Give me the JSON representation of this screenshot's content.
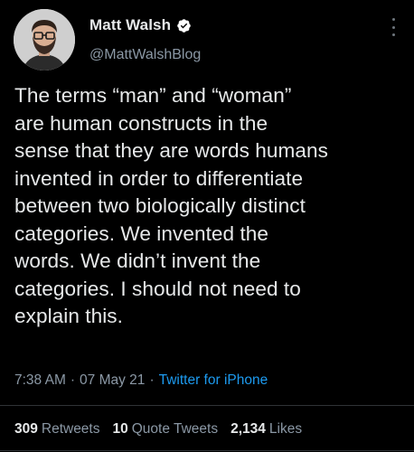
{
  "author": {
    "name": "Matt Walsh",
    "handle": "@MattWalshBlog",
    "verified_icon": "verified-badge-icon"
  },
  "tweet": {
    "text": "The terms “man” and “woman”\nare human constructs in the\nsense that they are words humans\ninvented in order to differentiate\nbetween two biologically distinct\ncategories. We invented the\nwords. We didn’t invent the\ncategories. I should not need to\nexplain this."
  },
  "meta": {
    "time": "7:38 AM",
    "separator1": "·",
    "date": "07 May 21",
    "separator2": "·",
    "source": "Twitter for iPhone"
  },
  "stats": {
    "retweets_count": "309",
    "retweets_label": "Retweets",
    "quotes_count": "10",
    "quotes_label": "Quote Tweets",
    "likes_count": "2,134",
    "likes_label": "Likes"
  },
  "colors": {
    "background": "#000000",
    "text": "#e7e9ea",
    "secondary": "#8b98a5",
    "link": "#1d9bf0",
    "verified": "#ffffff"
  }
}
